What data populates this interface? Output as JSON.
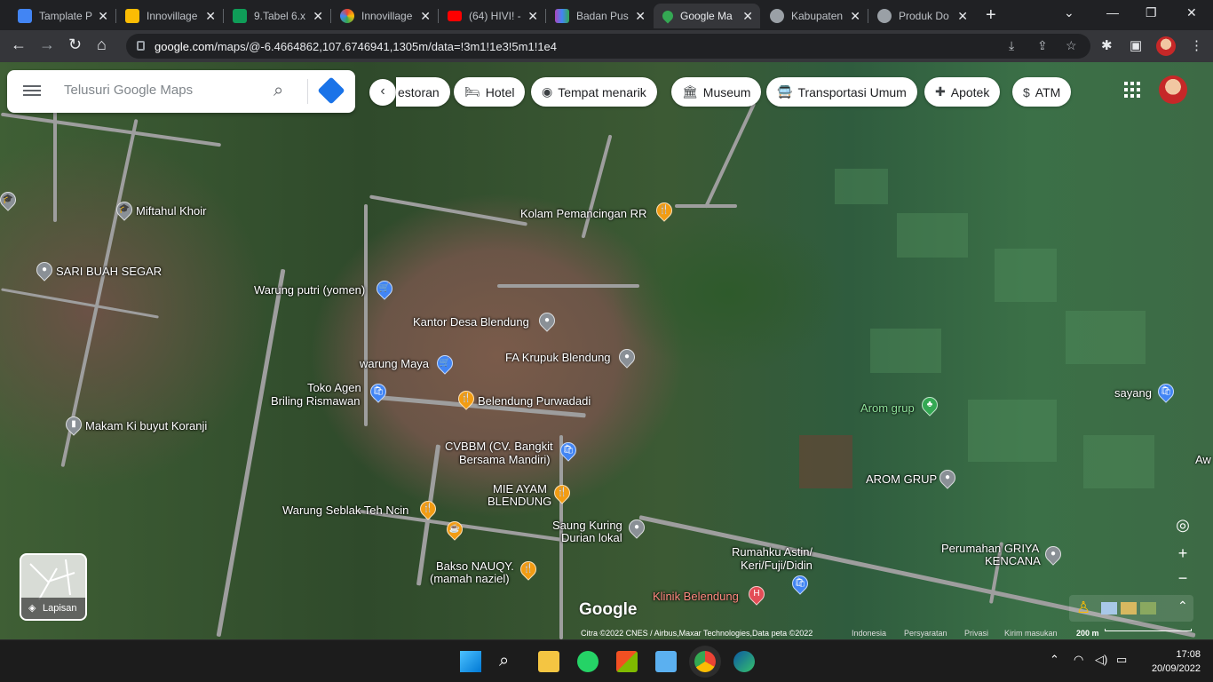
{
  "browser": {
    "tabs": [
      {
        "title": "Tamplate P",
        "favicon_color": "#4285f4"
      },
      {
        "title": "Innovillage",
        "favicon_color": "#fbbc04"
      },
      {
        "title": "9.Tabel 6.x",
        "favicon_color": "#0f9d58"
      },
      {
        "title": "Innovillage",
        "favicon_color": "#ea4335"
      },
      {
        "title": "(64) HIVI! -",
        "favicon_color": "#ff0000"
      },
      {
        "title": "Badan Pus",
        "favicon_color": "#ab47bc"
      },
      {
        "title": "Google Ma",
        "favicon_color": "#34a853",
        "active": true
      },
      {
        "title": "Kabupaten",
        "favicon_color": "#9aa0a6"
      },
      {
        "title": "Produk Do",
        "favicon_color": "#9aa0a6"
      }
    ],
    "close_glyph": "✕",
    "new_tab_glyph": "+",
    "url_host": "google.com",
    "url_path": "/maps/@-6.4664862,107.6746941,1305m/data=!3m1!1e3!5m1!1e4"
  },
  "maps": {
    "search_placeholder": "Telusuri Google Maps",
    "chips": [
      {
        "label": "estoran",
        "icon": "restaurant-icon",
        "glyph": ""
      },
      {
        "label": "Hotel",
        "icon": "hotel-icon",
        "glyph": "🛏"
      },
      {
        "label": "Tempat menarik",
        "icon": "attraction-icon",
        "glyph": "◉"
      },
      {
        "label": "Museum",
        "icon": "museum-icon",
        "glyph": "🏛"
      },
      {
        "label": "Transportasi Umum",
        "icon": "transit-icon",
        "glyph": "🚍"
      },
      {
        "label": "Apotek",
        "icon": "pharmacy-icon",
        "glyph": "✚"
      },
      {
        "label": "ATM",
        "icon": "atm-icon",
        "glyph": "$"
      }
    ],
    "places": [
      {
        "name": "Kolam Pemancingan RR",
        "pin": "orange",
        "glyph": "🍴"
      },
      {
        "name": "Miftahul Khoir",
        "pin": "grey",
        "glyph": "🎓"
      },
      {
        "name": "SARI BUAH SEGAR",
        "pin": "grey",
        "glyph": "●"
      },
      {
        "name": "Warung putri (yomen)",
        "pin": "blue",
        "glyph": "🛒"
      },
      {
        "name": "Kantor Desa Blendung",
        "pin": "grey",
        "glyph": "●"
      },
      {
        "name": "FA Krupuk Blendung",
        "pin": "grey",
        "glyph": "●"
      },
      {
        "name": "warung Maya",
        "pin": "blue",
        "glyph": "🛒"
      },
      {
        "name": "Toko Agen",
        "pin": "blue",
        "glyph": "🛍"
      },
      {
        "name": "Briling Rismawan",
        "pin": "",
        "glyph": ""
      },
      {
        "name": "Belendung Purwadadi",
        "pin": "orange",
        "glyph": "🍴"
      },
      {
        "name": "Makam Ki buyut Koranji",
        "pin": "grey",
        "glyph": "▮"
      },
      {
        "name": "CVBBM (CV. Bangkit",
        "pin": "blue",
        "glyph": "🛍"
      },
      {
        "name": "Bersama Mandiri)",
        "pin": "",
        "glyph": ""
      },
      {
        "name": "MIE AYAM",
        "pin": "orange",
        "glyph": "🍴"
      },
      {
        "name": "BLENDUNG",
        "pin": "",
        "glyph": ""
      },
      {
        "name": "Warung Seblak Teh Ncin",
        "pin": "orange",
        "glyph": "🍴"
      },
      {
        "name": "",
        "pin": "orange",
        "glyph": "☕"
      },
      {
        "name": "Saung Kuring",
        "pin": "grey",
        "glyph": "●"
      },
      {
        "name": "Durian lokal",
        "pin": "",
        "glyph": ""
      },
      {
        "name": "Bakso NAUQY.",
        "pin": "orange",
        "glyph": "🍴"
      },
      {
        "name": "(mamah naziel)",
        "pin": "",
        "glyph": ""
      },
      {
        "name": "Rumahku Astin/",
        "pin": "blue",
        "glyph": "🛍"
      },
      {
        "name": "Keri/Fuji/Didin",
        "pin": "",
        "glyph": ""
      },
      {
        "name": "Klinik Belendung",
        "pin": "red",
        "glyph": "H"
      },
      {
        "name": "Arom grup",
        "pin": "green",
        "glyph": "♣"
      },
      {
        "name": "AROM GRUP",
        "pin": "grey",
        "glyph": "●"
      },
      {
        "name": "sayang",
        "pin": "blue",
        "glyph": "🛍"
      },
      {
        "name": "Perumahan GRIYA",
        "pin": "grey",
        "glyph": "●"
      },
      {
        "name": "KENCANA",
        "pin": "",
        "glyph": ""
      },
      {
        "name": "Aw",
        "pin": "",
        "glyph": ""
      }
    ],
    "layers_label": "Lapisan",
    "logo": "Google",
    "attribution": "Citra ©2022 CNES / Airbus,Maxar Technologies,Data peta ©2022",
    "footer_links": [
      "Indonesia",
      "Persyaratan",
      "Privasi",
      "Kirim masukan"
    ],
    "scale_label": "200 m",
    "zoom_in": "+",
    "zoom_out": "−"
  },
  "taskbar": {
    "time": "17:08",
    "date": "20/09/2022"
  }
}
